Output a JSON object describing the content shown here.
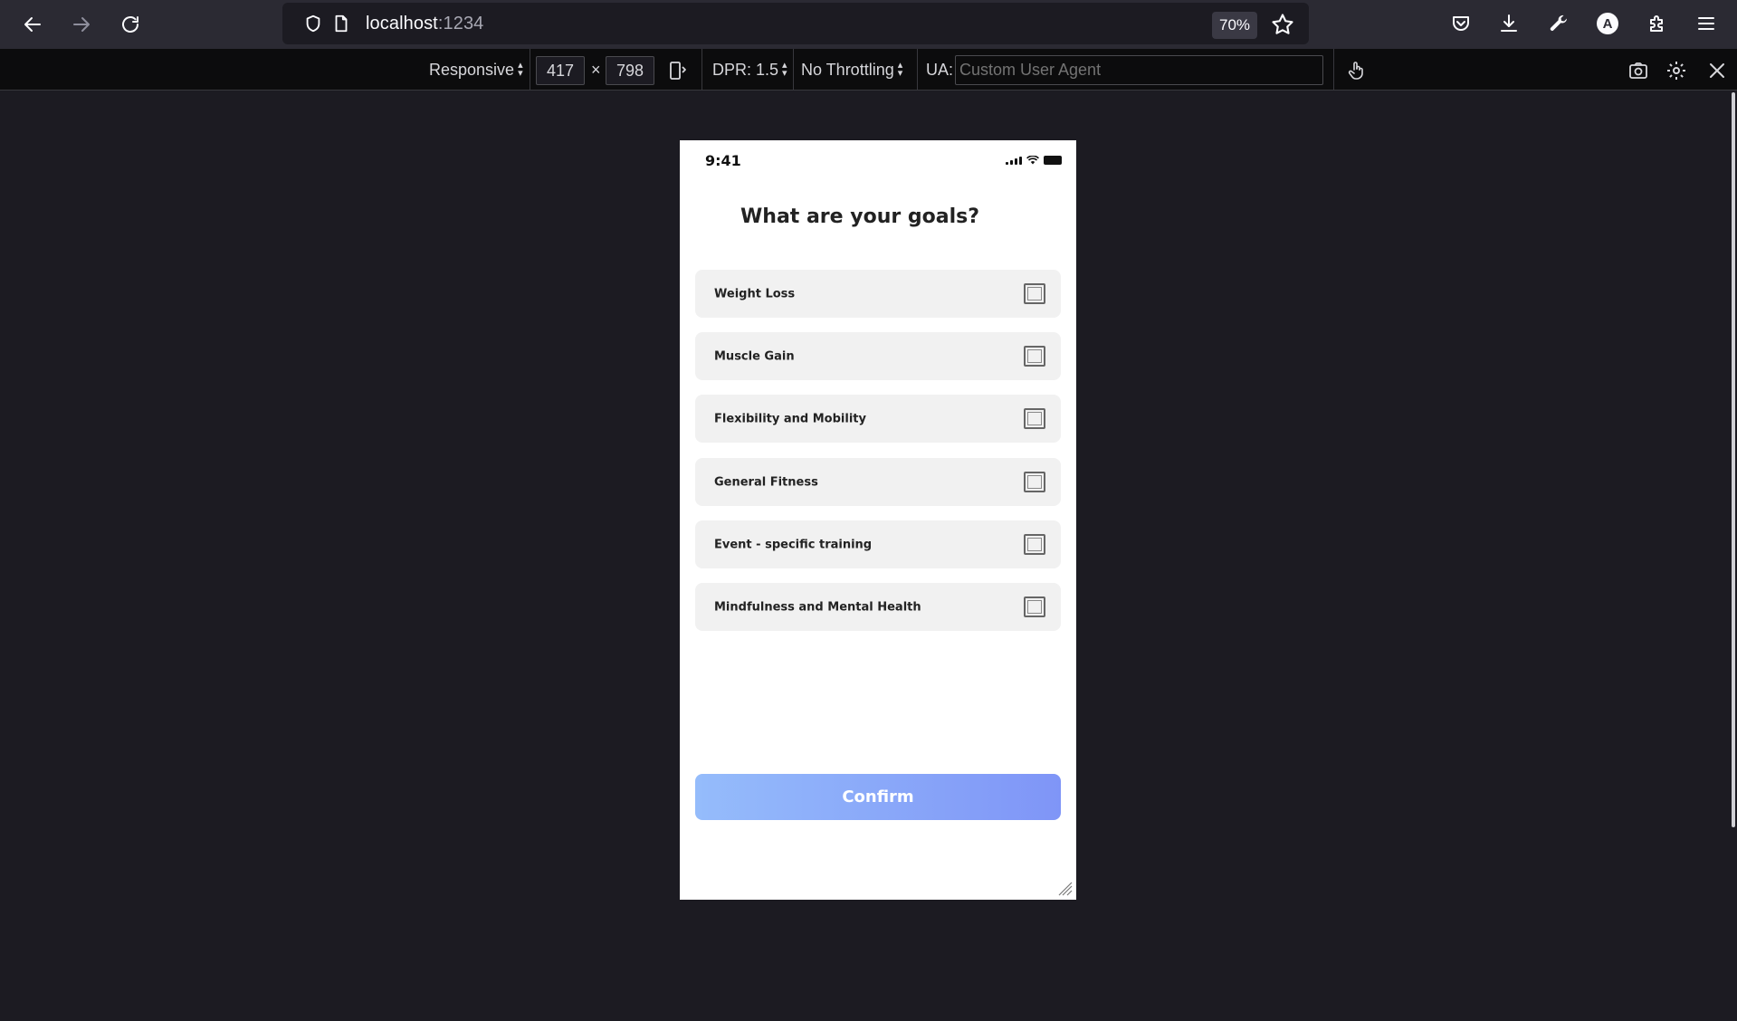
{
  "browser": {
    "url_host": "localhost",
    "url_port": ":1234",
    "zoom": "70%",
    "profile_initial": "A"
  },
  "devtools": {
    "device_label": "Responsive",
    "width": "417",
    "times": "×",
    "height": "798",
    "dpr_label": "DPR: 1.5",
    "throttling_label": "No Throttling",
    "ua_label": "UA:",
    "ua_placeholder": "Custom User Agent"
  },
  "phone": {
    "status_time": "9:41",
    "title": "What are your goals?",
    "goals": [
      {
        "label": "Weight Loss",
        "checked": false
      },
      {
        "label": "Muscle Gain",
        "checked": false
      },
      {
        "label": "Flexibility and Mobility",
        "checked": false
      },
      {
        "label": "General Fitness",
        "checked": false
      },
      {
        "label": "Event - specific training",
        "checked": false
      },
      {
        "label": "Mindfulness and Mental Health",
        "checked": false
      }
    ],
    "confirm_label": "Confirm",
    "confirm_gradient": [
      "#95bcfb",
      "#7f95f7"
    ]
  },
  "icons": {
    "back": "arrow-left-icon",
    "forward": "arrow-right-icon",
    "reload": "reload-icon",
    "shield": "shield-icon",
    "page": "page-icon",
    "bookmark": "star-icon",
    "pocket": "pocket-icon",
    "downloads": "download-icon",
    "devtools": "wrench-icon",
    "extensions": "puzzle-icon",
    "menu": "hamburger-menu-icon",
    "rotate": "rotate-device-icon",
    "touch": "touch-hand-icon",
    "screenshot": "camera-icon",
    "settings": "gear-icon",
    "close": "close-icon"
  }
}
